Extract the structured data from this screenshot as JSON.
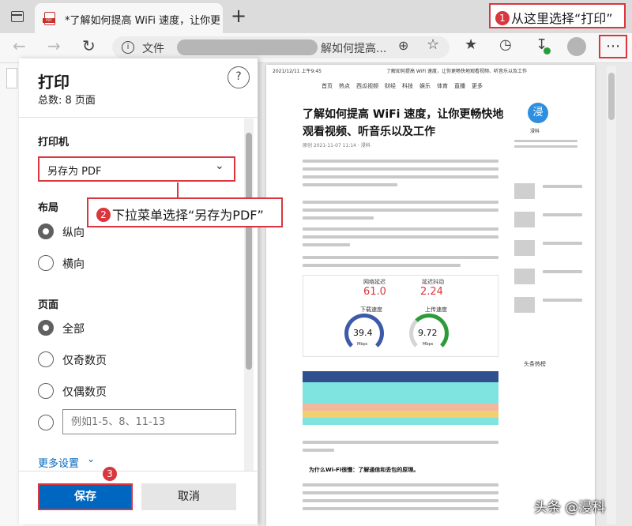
{
  "browser": {
    "tab_title": "*了解如何提高 WiFi 速度，让你更",
    "new_tab_symbol": "+",
    "address_scheme_label": "文件",
    "address_page_text": "解如何提高..."
  },
  "print_dialog": {
    "title": "打印",
    "help_symbol": "?",
    "total_pages": "总数: 8 页面",
    "printer_label": "打印机",
    "printer_value": "另存为 PDF",
    "layout_label": "布局",
    "layout_options": [
      "纵向",
      "横向"
    ],
    "pages_label": "页面",
    "pages_options": [
      "全部",
      "仅奇数页",
      "仅偶数页"
    ],
    "custom_pages_placeholder": "例如1-5、8、11-13",
    "more_settings": "更多设置",
    "save_button": "保存",
    "cancel_button": "取消"
  },
  "annotations": {
    "step1_num": "1",
    "step1_text": "从这里选择“打印”",
    "step2_num": "2",
    "step2_text": "下拉菜单选择“另存为PDF”",
    "step3_num": "3"
  },
  "preview": {
    "header_date": "2021/12/11 上午9:45",
    "header_title": "了解如何提高 WiFi 速度，让你更畅快地观看视频、听音乐以及工作",
    "nav": [
      "首页",
      "热点",
      "西瓜视频",
      "财经",
      "科技",
      "娱乐",
      "体育",
      "直播",
      "更多"
    ],
    "article_title_1": "了解如何提高 WiFi 速度，让你更畅快地",
    "article_title_2": "观看视频、听音乐以及工作",
    "article_meta": "原创   2021-11-07 11:14 · 浸科",
    "side_avatar": "浸",
    "side_name": "浸科",
    "side_hot": "头条热榜",
    "speed_latency_label": "网络延迟",
    "speed_latency_value": "61.0",
    "speed_jitter_label": "延迟抖动",
    "speed_jitter_value": "2.24",
    "speed_down_label": "下载速度",
    "speed_down_value": "39.4",
    "speed_up_label": "上传速度",
    "speed_up_value": "9.72",
    "speed_unit": "Mbps",
    "subheading": "为什么Wi-Fi很慢：了解通信和丢包的原理。"
  },
  "watermark": "头条 @浸科",
  "colors": {
    "accent": "#0067c0",
    "annotation_red": "#d9363e",
    "gauge_blue": "#3d5aa8",
    "gauge_green": "#2e9b3a"
  }
}
